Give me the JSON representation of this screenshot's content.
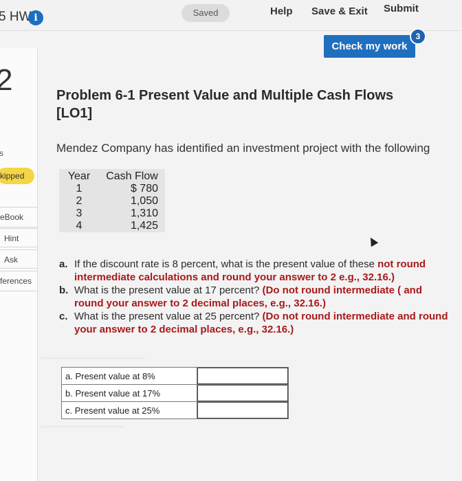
{
  "header": {
    "hw_title": "5 HW",
    "info_icon": "i",
    "saved_label": "Saved",
    "help_label": "Help",
    "save_exit_label": "Save & Exit",
    "submit_label": "Submit",
    "check_work_label": "Check my work",
    "check_badge_count": "3"
  },
  "sidebar": {
    "question_number": "2",
    "points_label": "s",
    "skipped_label": "kipped",
    "ebook_label": "eBook",
    "hint_label": "Hint",
    "ask_label": "Ask",
    "references_label": "ferences"
  },
  "problem": {
    "title": "Problem 6-1 Present Value and Multiple Cash Flows [LO1]",
    "intro": "Mendez Company has identified an investment project with the following",
    "table": {
      "headers": [
        "Year",
        "Cash Flow"
      ],
      "rows": [
        {
          "year": "1",
          "cash_flow": "$ 780"
        },
        {
          "year": "2",
          "cash_flow": "1,050"
        },
        {
          "year": "3",
          "cash_flow": "1,310"
        },
        {
          "year": "4",
          "cash_flow": "1,425"
        }
      ]
    },
    "questions": [
      {
        "letter": "a.",
        "text": "If the discount rate is 8 percent, what is the present value of these",
        "bold_text": "not round intermediate calculations and round your answer to 2 e.g., 32.16.)"
      },
      {
        "letter": "b.",
        "text": "What is the present value at 17 percent?",
        "bold_text": "(Do not round intermediate ( and round your answer to 2 decimal places, e.g., 32.16.)"
      },
      {
        "letter": "c.",
        "text": "What is the present value at 25 percent?",
        "bold_text": "(Do not round intermediate and round your answer to 2 decimal places, e.g., 32.16.)"
      }
    ],
    "answers": [
      {
        "label": "a. Present value at 8%",
        "value": ""
      },
      {
        "label": "b. Present value at 17%",
        "value": ""
      },
      {
        "label": "c. Present value at 25%",
        "value": ""
      }
    ]
  },
  "colors": {
    "accent_blue": "#1f6fbf",
    "skipped_yellow": "#f5d545",
    "instruction_red": "#a8191a"
  }
}
